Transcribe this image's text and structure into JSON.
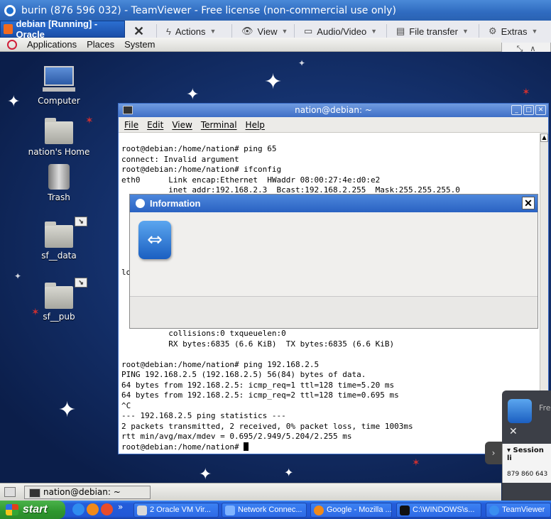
{
  "window": {
    "title": "burin (876 596 032) - TeamViewer - Free license (non-commercial use only)"
  },
  "vbox_tab": {
    "label": "debian [Running] - Oracle"
  },
  "tv_toolbar": {
    "close_glyph": "✕",
    "actions": "Actions",
    "view": "View",
    "audio_video": "Audio/Video",
    "file_transfer": "File transfer",
    "extras": "Extras",
    "icons": [
      "close-session-icon",
      "lightning-icon",
      "eye-icon",
      "chat-icon",
      "file-icon",
      "gear-icon"
    ]
  },
  "gnome_panel": {
    "applications": "Applications",
    "places": "Places",
    "system": "System"
  },
  "desktop_icons": [
    {
      "label": "Computer",
      "icon": "computer-icon"
    },
    {
      "label": "nation's Home",
      "icon": "home-folder-icon"
    },
    {
      "label": "Trash",
      "icon": "trash-icon"
    },
    {
      "label": "sf__data",
      "icon": "shared-folder-icon"
    },
    {
      "label": "sf__pub",
      "icon": "shared-folder-icon"
    }
  ],
  "terminal": {
    "title": "nation@debian: ~",
    "menu": [
      "File",
      "Edit",
      "View",
      "Terminal",
      "Help"
    ],
    "lines_top": [
      "root@debian:/home/nation# ping 65",
      "connect: Invalid argument",
      "root@debian:/home/nation# ifconfig",
      "eth0      Link encap:Ethernet  HWaddr 08:00:27:4e:d0:e2",
      "          inet addr:192.168.2.3  Bcast:192.168.2.255  Mask:255.255.255.0"
    ],
    "partial_line": "lo",
    "lines_bottom": [
      "          collisions:0 txqueuelen:0",
      "          RX bytes:6835 (6.6 KiB)  TX bytes:6835 (6.6 KiB)",
      "",
      "root@debian:/home/nation# ping 192.168.2.5",
      "PING 192.168.2.5 (192.168.2.5) 56(84) bytes of data.",
      "64 bytes from 192.168.2.5: icmp_req=1 ttl=128 time=5.20 ms",
      "64 bytes from 192.168.2.5: icmp_req=2 ttl=128 time=0.695 ms",
      "^C",
      "--- 192.168.2.5 ping statistics ---",
      "2 packets transmitted, 2 received, 0% packet loss, time 1003ms",
      "rtt min/avg/max/mdev = 0.695/2.949/5.204/2.255 ms"
    ],
    "prompt": "root@debian:/home/nation# "
  },
  "info_dialog": {
    "title": "Information",
    "close": "✕"
  },
  "tv_side": {
    "free_label": "Fre",
    "close": "✕",
    "tab_glyph": "›",
    "session_list_label": "Session li",
    "session_id": "879 860 643"
  },
  "gnome_bottom": {
    "task_label": "nation@debian: ~"
  },
  "xp_taskbar": {
    "start": "start",
    "overflow": "»",
    "tasks": [
      {
        "label": "2 Oracle VM Vir...",
        "icon": "virtualbox-icon",
        "color": "#d8d8d8"
      },
      {
        "label": "Network Connec...",
        "icon": "network-icon",
        "color": "#7fb3ff"
      },
      {
        "label": "Google - Mozilla ...",
        "icon": "firefox-icon",
        "color": "#f08a1a"
      },
      {
        "label": "C:\\WINDOWS\\s...",
        "icon": "cmd-icon",
        "color": "#111111"
      },
      {
        "label": "TeamViewer",
        "icon": "teamviewer-icon",
        "color": "#3a8ef0"
      }
    ]
  }
}
